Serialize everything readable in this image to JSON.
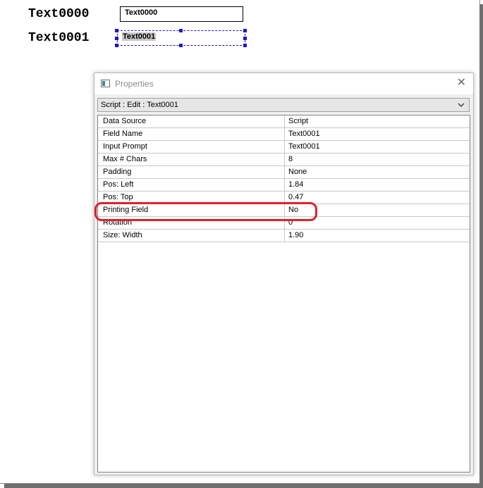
{
  "canvas": {
    "fields": [
      {
        "label": "Text0000",
        "value": "Text0000"
      },
      {
        "label": "Text0001",
        "value": "Text0001"
      }
    ]
  },
  "properties_window": {
    "title": "Properties",
    "close_glyph": "✕",
    "selector": "Script : Edit : Text0001",
    "rows": [
      {
        "name": "Data Source",
        "value": "Script"
      },
      {
        "name": "Field Name",
        "value": "Text0001"
      },
      {
        "name": "Input Prompt",
        "value": "Text0001"
      },
      {
        "name": "Max # Chars",
        "value": "8"
      },
      {
        "name": "Padding",
        "value": "None"
      },
      {
        "name": "Pos: Left",
        "value": "1.84"
      },
      {
        "name": "Pos: Top",
        "value": "0.47"
      },
      {
        "name": "Printing Field",
        "value": "No"
      },
      {
        "name": "Rotation",
        "value": "0"
      },
      {
        "name": "Size: Width",
        "value": "1.90"
      }
    ]
  },
  "colors": {
    "highlight": "#e0212b",
    "selection": "#1a1acc"
  }
}
